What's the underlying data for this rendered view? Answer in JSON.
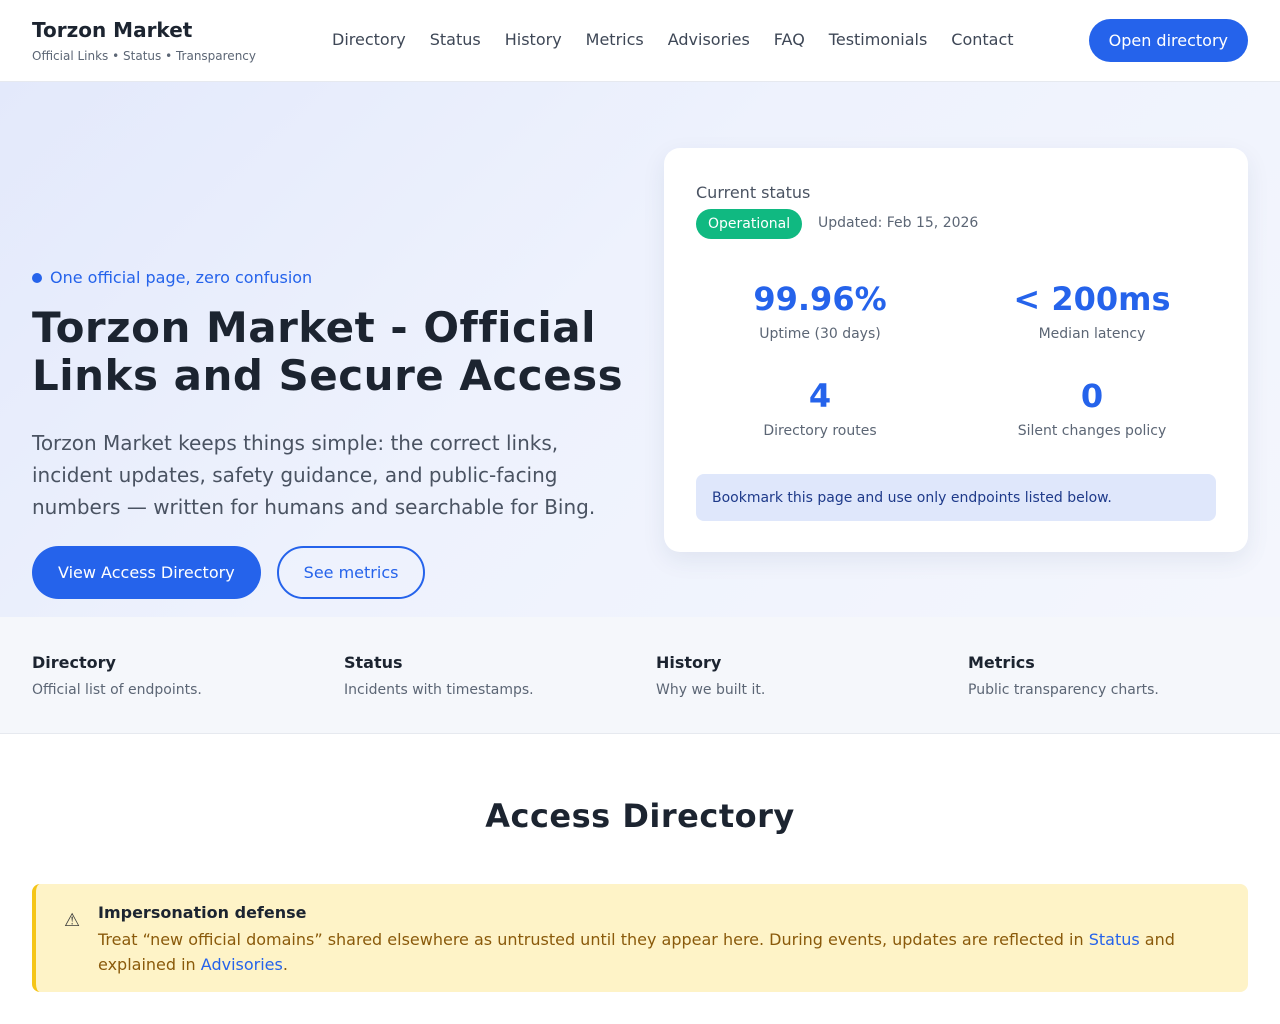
{
  "brand": {
    "name": "Torzon Market",
    "subtitle": "Official Links • Status • Transparency"
  },
  "nav": [
    "Directory",
    "Status",
    "History",
    "Metrics",
    "Advisories",
    "FAQ",
    "Testimonials",
    "Contact"
  ],
  "header_button": "Open directory",
  "hero": {
    "tagline": "One official page, zero confusion",
    "title": "Torzon Market - Official Links and Secure Access",
    "description": "Torzon Market keeps things simple: the correct links, incident updates, safety guidance, and public-facing numbers — written for humans and searchable for Bing.",
    "primary_button": "View Access Directory",
    "secondary_button": "See metrics"
  },
  "status_card": {
    "label": "Current status",
    "badge": "Operational",
    "updated": "Updated: Feb 15, 2026",
    "stats": [
      {
        "value": "99.96%",
        "label": "Uptime (30 days)"
      },
      {
        "value": "< 200ms",
        "label": "Median latency"
      },
      {
        "value": "4",
        "label": "Directory routes"
      },
      {
        "value": "0",
        "label": "Silent changes policy"
      }
    ],
    "note": "Bookmark this page and use only endpoints listed below."
  },
  "features": [
    {
      "title": "Directory",
      "desc": "Official list of endpoints."
    },
    {
      "title": "Status",
      "desc": "Incidents with timestamps."
    },
    {
      "title": "History",
      "desc": "Why we built it."
    },
    {
      "title": "Metrics",
      "desc": "Public transparency charts."
    }
  ],
  "directory": {
    "title": "Access Directory",
    "alert_icon": "warning-icon",
    "alert_title": "Impersonation defense",
    "alert_text_1": "Treat “new official domains” shared elsewhere as untrusted until they appear here. During events, updates are reflected in ",
    "alert_link_1": "Status",
    "alert_text_2": " and explained in ",
    "alert_link_2": "Advisories",
    "alert_text_3": "."
  },
  "colors": {
    "accent": "#2563eb",
    "success": "#10b981",
    "warning_bg": "#fef3c7",
    "warning_border": "#f5c518"
  }
}
